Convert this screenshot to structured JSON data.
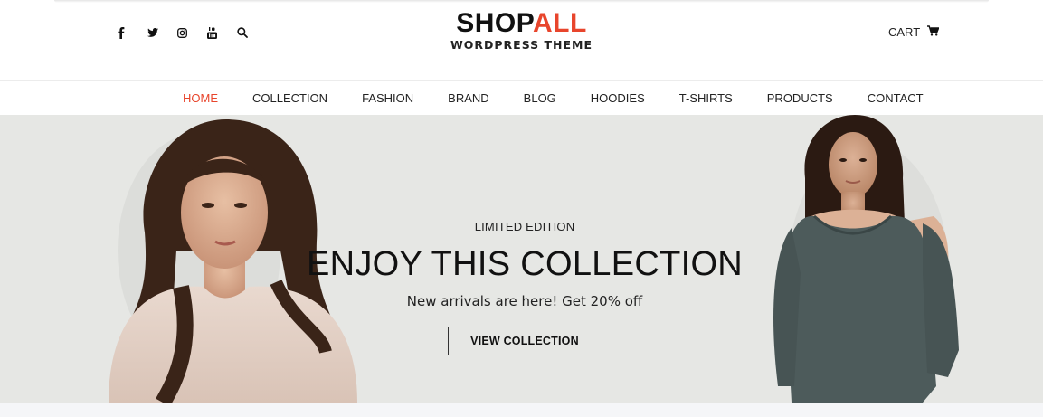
{
  "header": {
    "social_icons": [
      "facebook-icon",
      "twitter-icon",
      "instagram-icon",
      "youtube-icon",
      "search-icon"
    ],
    "logo": {
      "main_dark": "SHOP",
      "main_accent": "ALL",
      "sub": "WORDPRESS THEME"
    },
    "cart_label": "CART",
    "accent_color": "#e8452c"
  },
  "nav": {
    "items": [
      {
        "label": "HOME",
        "active": true
      },
      {
        "label": "COLLECTION"
      },
      {
        "label": "FASHION"
      },
      {
        "label": "BRAND"
      },
      {
        "label": "BLOG"
      },
      {
        "label": "HOODIES"
      },
      {
        "label": "T-SHIRTS"
      },
      {
        "label": "PRODUCTS"
      },
      {
        "label": "CONTACT"
      }
    ]
  },
  "hero": {
    "kicker": "LIMITED EDITION",
    "headline": "ENJOY THIS COLLECTION",
    "subline": "New arrivals are here! Get 20% off",
    "cta_label": "VIEW COLLECTION",
    "background_color": "#e6e7e4"
  }
}
